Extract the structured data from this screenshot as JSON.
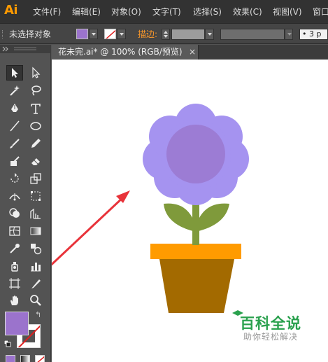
{
  "app": {
    "logo_text": "Ai",
    "accent_color": "#ff9a00"
  },
  "menu": [
    {
      "label": "文件(F)"
    },
    {
      "label": "编辑(E)"
    },
    {
      "label": "对象(O)"
    },
    {
      "label": "文字(T)"
    },
    {
      "label": "选择(S)"
    },
    {
      "label": "效果(C)"
    },
    {
      "label": "视图(V)"
    },
    {
      "label": "窗口"
    }
  ],
  "control_bar": {
    "selection_status": "未选择对象",
    "fill_color": "#9b73cc",
    "stroke_color": "none",
    "stroke_label": "描边:",
    "stroke_weight": "",
    "brush_value": "• 3 p"
  },
  "document": {
    "tab_title": "花未完.ai* @ 100% (RGB/预览)",
    "close_glyph": "×"
  },
  "tools": [
    {
      "name": "selection-tool",
      "glyph": "arrow"
    },
    {
      "name": "direct-selection-tool",
      "glyph": "white-arrow"
    },
    {
      "name": "magic-wand-tool",
      "glyph": "wand"
    },
    {
      "name": "lasso-tool",
      "glyph": "lasso"
    },
    {
      "name": "pen-tool",
      "glyph": "pen"
    },
    {
      "name": "type-tool",
      "glyph": "T"
    },
    {
      "name": "line-tool",
      "glyph": "line"
    },
    {
      "name": "ellipse-tool",
      "glyph": "ellipse"
    },
    {
      "name": "paintbrush-tool",
      "glyph": "brush"
    },
    {
      "name": "pencil-tool",
      "glyph": "pencil"
    },
    {
      "name": "blob-brush-tool",
      "glyph": "blob"
    },
    {
      "name": "eraser-tool",
      "glyph": "eraser"
    },
    {
      "name": "rotate-tool",
      "glyph": "rotate"
    },
    {
      "name": "scale-tool",
      "glyph": "scale"
    },
    {
      "name": "width-tool",
      "glyph": "width"
    },
    {
      "name": "free-transform-tool",
      "glyph": "free-transform"
    },
    {
      "name": "shape-builder-tool",
      "glyph": "shape-builder"
    },
    {
      "name": "perspective-grid-tool",
      "glyph": "perspective"
    },
    {
      "name": "mesh-tool",
      "glyph": "mesh"
    },
    {
      "name": "gradient-tool",
      "glyph": "gradient"
    },
    {
      "name": "eyedropper-tool",
      "glyph": "eyedropper"
    },
    {
      "name": "blend-tool",
      "glyph": "blend"
    },
    {
      "name": "symbol-sprayer-tool",
      "glyph": "symbol"
    },
    {
      "name": "column-graph-tool",
      "glyph": "graph"
    },
    {
      "name": "artboard-tool",
      "glyph": "artboard"
    },
    {
      "name": "slice-tool",
      "glyph": "slice"
    },
    {
      "name": "hand-tool",
      "glyph": "hand"
    },
    {
      "name": "zoom-tool",
      "glyph": "zoom"
    }
  ],
  "swatches": {
    "fill_color": "#9b73cc",
    "stroke_color": "none",
    "swap_glyph": "↰"
  },
  "artwork": {
    "petal_color": "#a593f0",
    "center_color": "#9c7cd4",
    "stem_color": "#7f9a3b",
    "pot_rim_color": "#ff9b00",
    "pot_color": "#a36a00",
    "arrow_color": "#e8333a"
  },
  "watermark": {
    "title": "百科全说",
    "subtitle": "助你轻松解决",
    "color": "#2aa14e"
  }
}
